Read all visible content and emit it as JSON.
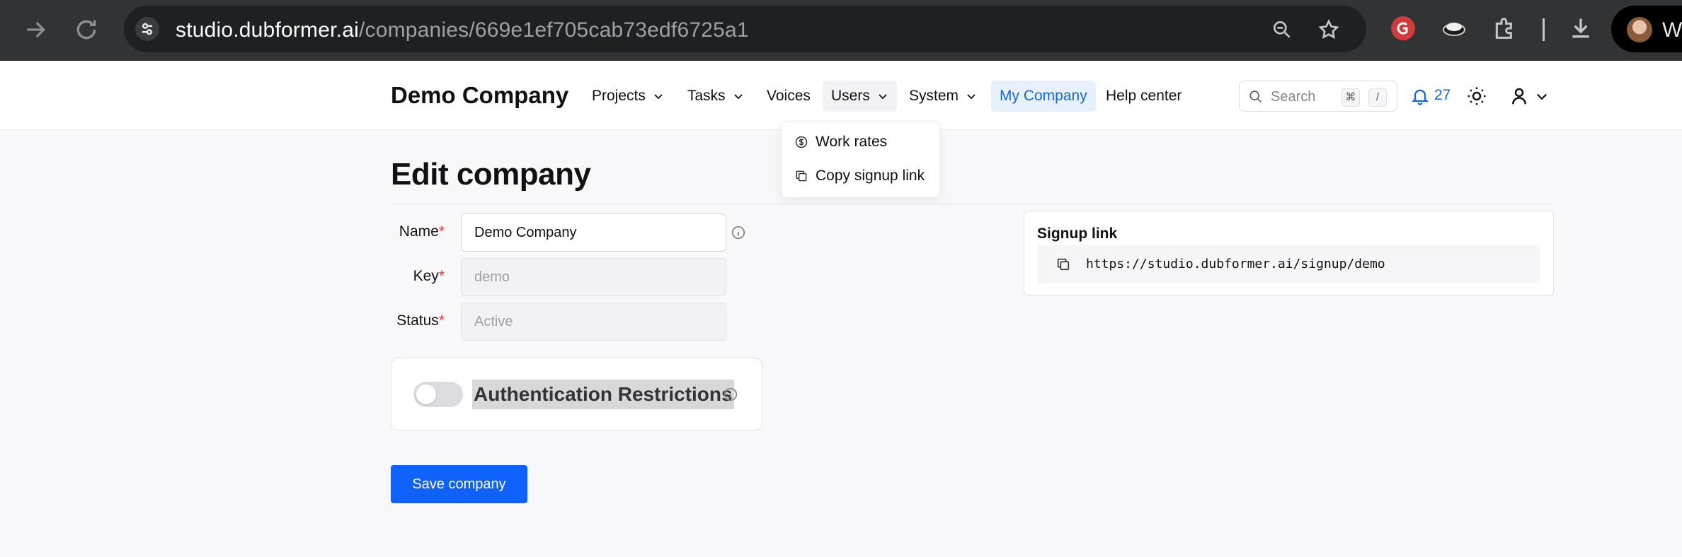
{
  "browser": {
    "url_host": "studio.dubformer.ai",
    "url_path": "/companies/669e1ef705cab73edf6725a1",
    "profile_initial": "W"
  },
  "header": {
    "brand": "Demo Company",
    "nav": [
      {
        "label": "Projects"
      },
      {
        "label": "Tasks"
      },
      {
        "label": "Voices"
      },
      {
        "label": "Users"
      },
      {
        "label": "System"
      },
      {
        "label": "My Company"
      },
      {
        "label": "Help center"
      }
    ],
    "search_placeholder": "Search",
    "shortcut_mod": "⌘",
    "shortcut_key": "/",
    "notification_count": "27"
  },
  "users_menu": {
    "items": [
      {
        "label": "Work rates"
      },
      {
        "label": "Copy signup link"
      }
    ]
  },
  "page": {
    "title": "Edit company",
    "fields": {
      "name_label": "Name",
      "name_value": "Demo Company",
      "key_label": "Key",
      "key_value": "demo",
      "status_label": "Status",
      "status_value": "Active",
      "required_mark": "*"
    },
    "auth_label": "Authentication Restrictions",
    "auth_enabled": false,
    "save_label": "Save company",
    "signup_title": "Signup link",
    "signup_url": "https://studio.dubformer.ai/signup/demo"
  }
}
